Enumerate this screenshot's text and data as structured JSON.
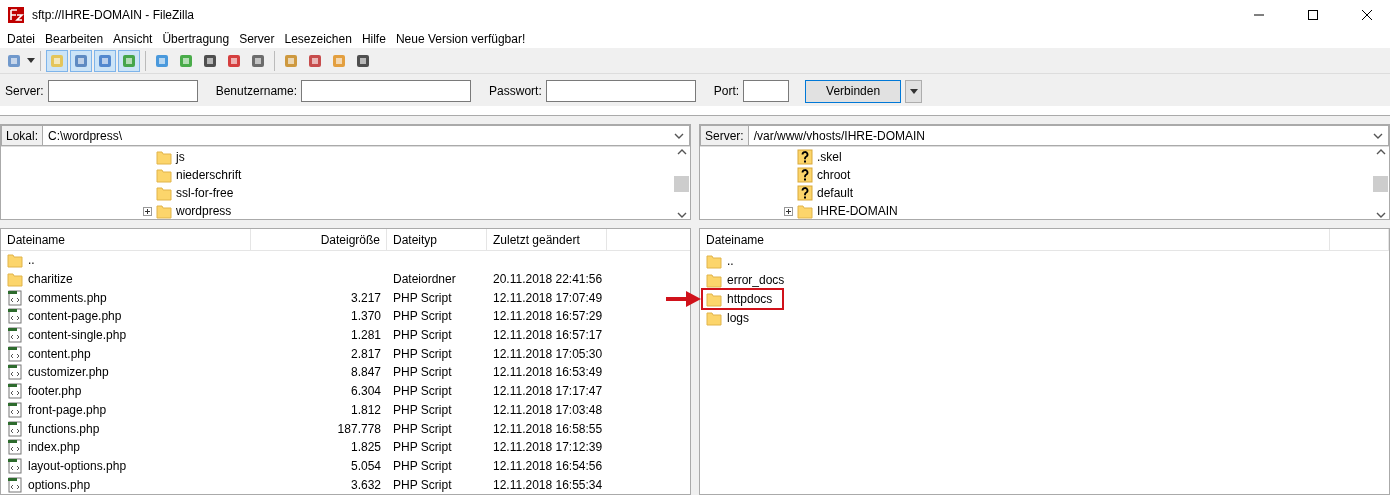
{
  "window": {
    "title": "sftp://IHRE-DOMAIN - FileZilla"
  },
  "menu": [
    "Datei",
    "Bearbeiten",
    "Ansicht",
    "Übertragung",
    "Server",
    "Lesezeichen",
    "Hilfe",
    "Neue Version verfügbar!"
  ],
  "quickconnect": {
    "fields": [
      {
        "label": "Server:",
        "kind": "text"
      },
      {
        "label": "Benutzername:",
        "kind": "text"
      },
      {
        "label": "Passwort:",
        "kind": "text"
      },
      {
        "label": "Port:",
        "kind": "port"
      }
    ],
    "button": "Verbinden"
  },
  "local": {
    "path_label": "Lokal:",
    "path": "C:\\wordpress\\",
    "tree": [
      {
        "name": "js",
        "kind": "folder",
        "expandable": false
      },
      {
        "name": "niederschrift",
        "kind": "folder",
        "expandable": false
      },
      {
        "name": "ssl-for-free",
        "kind": "folder",
        "expandable": false
      },
      {
        "name": "wordpress",
        "kind": "folder",
        "expandable": true
      }
    ],
    "columns": [
      "Dateiname",
      "Dateigröße",
      "Dateityp",
      "Zuletzt geändert"
    ],
    "rows": [
      {
        "name": "..",
        "kind": "folder",
        "size": "",
        "type": "",
        "modified": ""
      },
      {
        "name": "charitize",
        "kind": "folder",
        "size": "",
        "type": "Dateiordner",
        "modified": "20.11.2018 22:41:56"
      },
      {
        "name": "comments.php",
        "kind": "script",
        "size": "3.217",
        "type": "PHP Script",
        "modified": "12.11.2018 17:07:49"
      },
      {
        "name": "content-page.php",
        "kind": "script",
        "size": "1.370",
        "type": "PHP Script",
        "modified": "12.11.2018 16:57:29"
      },
      {
        "name": "content-single.php",
        "kind": "script",
        "size": "1.281",
        "type": "PHP Script",
        "modified": "12.11.2018 16:57:17"
      },
      {
        "name": "content.php",
        "kind": "script",
        "size": "2.817",
        "type": "PHP Script",
        "modified": "12.11.2018 17:05:30"
      },
      {
        "name": "customizer.php",
        "kind": "script",
        "size": "8.847",
        "type": "PHP Script",
        "modified": "12.11.2018 16:53:49"
      },
      {
        "name": "footer.php",
        "kind": "script",
        "size": "6.304",
        "type": "PHP Script",
        "modified": "12.11.2018 17:17:47"
      },
      {
        "name": "front-page.php",
        "kind": "script",
        "size": "1.812",
        "type": "PHP Script",
        "modified": "12.11.2018 17:03:48"
      },
      {
        "name": "functions.php",
        "kind": "script",
        "size": "187.778",
        "type": "PHP Script",
        "modified": "12.11.2018 16:58:55"
      },
      {
        "name": "index.php",
        "kind": "script",
        "size": "1.825",
        "type": "PHP Script",
        "modified": "12.11.2018 17:12:39"
      },
      {
        "name": "layout-options.php",
        "kind": "script",
        "size": "5.054",
        "type": "PHP Script",
        "modified": "12.11.2018 16:54:56"
      },
      {
        "name": "options.php",
        "kind": "script",
        "size": "3.632",
        "type": "PHP Script",
        "modified": "12.11.2018 16:55:34"
      }
    ]
  },
  "remote": {
    "path_label": "Server:",
    "path": "/var/www/vhosts/IHRE-DOMAIN",
    "tree": [
      {
        "name": ".skel",
        "kind": "unknown",
        "expandable": false
      },
      {
        "name": "chroot",
        "kind": "unknown",
        "expandable": false
      },
      {
        "name": "default",
        "kind": "unknown",
        "expandable": false
      },
      {
        "name": "IHRE-DOMAIN",
        "kind": "folder",
        "expandable": true
      }
    ],
    "columns": [
      "Dateiname"
    ],
    "rows": [
      {
        "name": "..",
        "highlighted": false
      },
      {
        "name": "error_docs",
        "highlighted": false
      },
      {
        "name": "httpdocs",
        "highlighted": true
      },
      {
        "name": "logs",
        "highlighted": false
      }
    ]
  }
}
